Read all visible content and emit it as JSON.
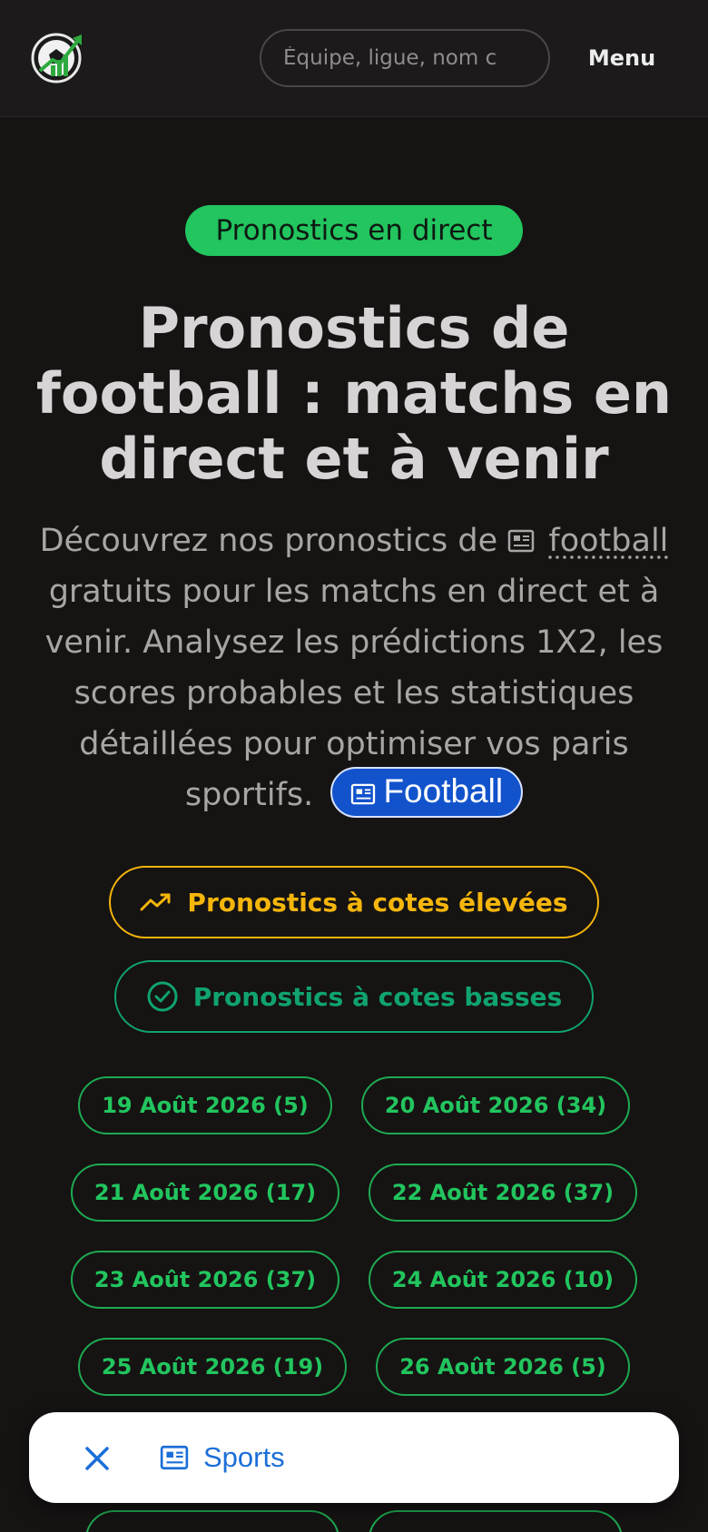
{
  "header": {
    "search_placeholder": "Équipe, ligue, nom c",
    "menu_label": "Menu"
  },
  "hero": {
    "badge": "Pronostics en direct",
    "title": "Pronostics de football : matchs en direct et à venir",
    "desc_before": "Découvrez nos pronostics de",
    "desc_link": "football",
    "desc_after": "gratuits pour les matchs en direct et à venir. Analysez les prédictions 1X2, les scores probables et les statistiques détaillées pour optimiser vos paris sportifs.",
    "chip_label": "Football"
  },
  "filters": {
    "high_odds": "Pronostics à cotes élevées",
    "low_odds": "Pronostics à cotes basses"
  },
  "dates": [
    "19 Août 2026 (5)",
    "20 Août 2026 (34)",
    "21 Août 2026 (17)",
    "22 Août 2026 (37)",
    "23 Août 2026 (37)",
    "24 Août 2026 (10)",
    "25 Août 2026 (19)",
    "26 Août 2026 (5)"
  ],
  "toast": {
    "label": "Sports"
  },
  "colors": {
    "background": "#161313",
    "accent_green": "#22c55e",
    "accent_yellow": "#f5b60b",
    "accent_teal": "#10a36f",
    "chip_blue": "#1253cc",
    "toast_blue": "#1b6ed8"
  },
  "icons": {
    "logo": "soccer-ball-chart-logo",
    "trend": "trending-up-icon",
    "check": "check-circle-icon",
    "doc": "newspaper-icon",
    "close": "close-icon"
  }
}
